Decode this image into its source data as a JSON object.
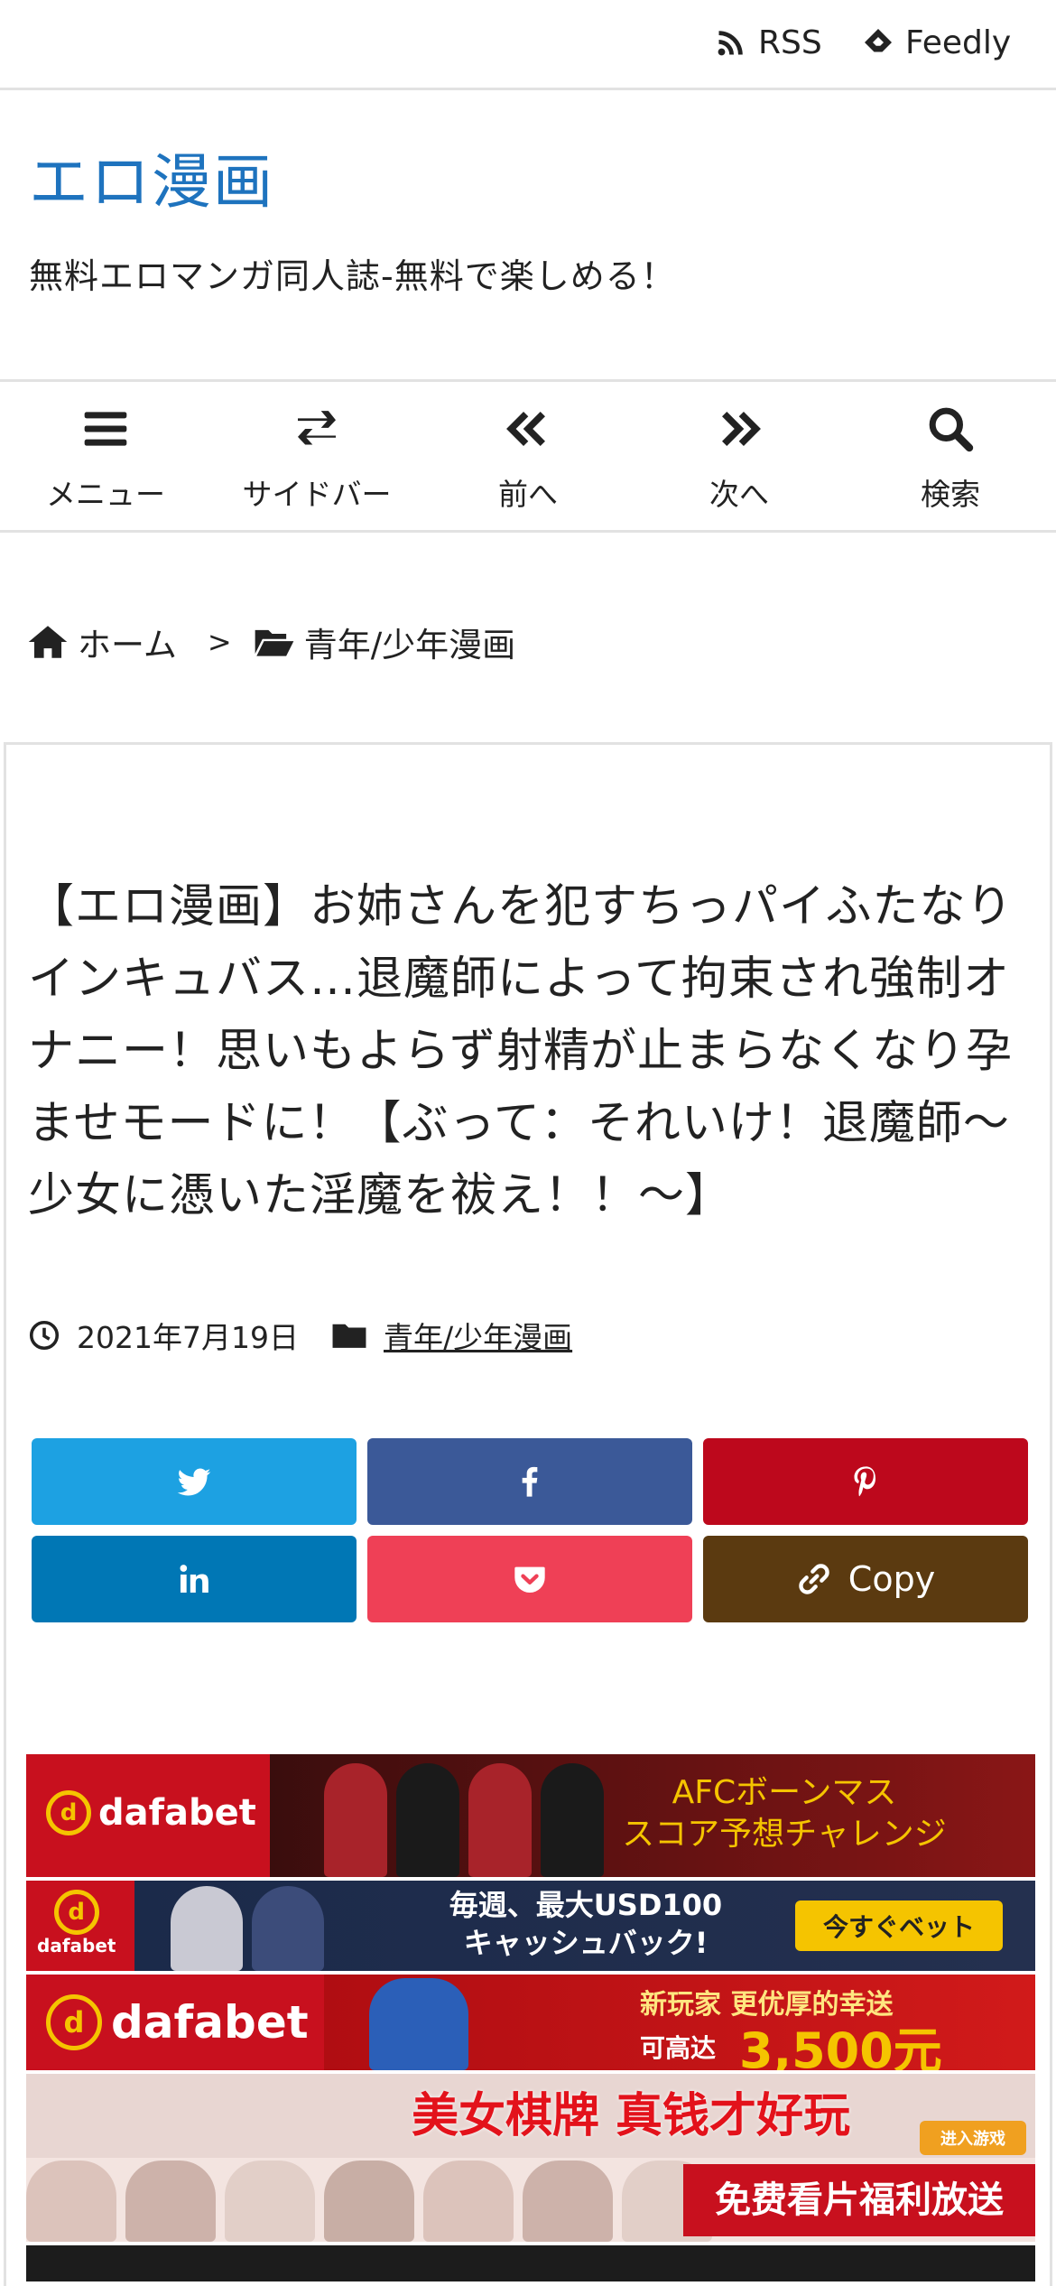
{
  "topbar": {
    "rss_label": "RSS",
    "feedly_label": "Feedly"
  },
  "header": {
    "title": "エロ漫画",
    "description": "無料エロマンガ同人誌-無料で楽しめる！"
  },
  "nav": {
    "menu": "メニュー",
    "sidebar": "サイドバー",
    "prev": "前へ",
    "next": "次へ",
    "search": "検索"
  },
  "breadcrumb": {
    "home": "ホーム",
    "separator": ">",
    "category": "青年/少年漫画"
  },
  "article": {
    "title": "【エロ漫画】お姉さんを犯すちっパイふたなりインキュバス…退魔師によって拘束され強制オナニー！思いもよらず射精が止まらなくなり孕ませモードに！【ぶって：それいけ！退魔師～少女に憑いた淫魔を祓え！！～】",
    "date": "2021年7月19日",
    "category": "青年/少年漫画"
  },
  "share": {
    "copy_label": "Copy",
    "colors": {
      "twitter": "#1da1e2",
      "facebook": "#3b5998",
      "pinterest": "#bd081c",
      "linkedin": "#0077b5",
      "pocket": "#ef4056",
      "copy": "#5b3a10"
    }
  },
  "ads": {
    "ad1": {
      "brand": "dafabet",
      "text": "AFCボーンマス\nスコア予想チャレンジ"
    },
    "ad2": {
      "brand": "dafabet",
      "text": "毎週、最大USD100\nキャッシュバック!",
      "button": "今すぐベット"
    },
    "ad3": {
      "brand": "dafabet",
      "text1": "新玩家 更优厚的幸送",
      "text2": "可高达",
      "amount": "3,500元"
    },
    "ad4": {
      "text1": "美女棋牌 真钱才好玩",
      "button": "进入游戏",
      "text2": "免费看片福利放送"
    }
  },
  "colors": {
    "title": "#1e73be",
    "border": "#e2e2e2",
    "text": "#222222"
  }
}
